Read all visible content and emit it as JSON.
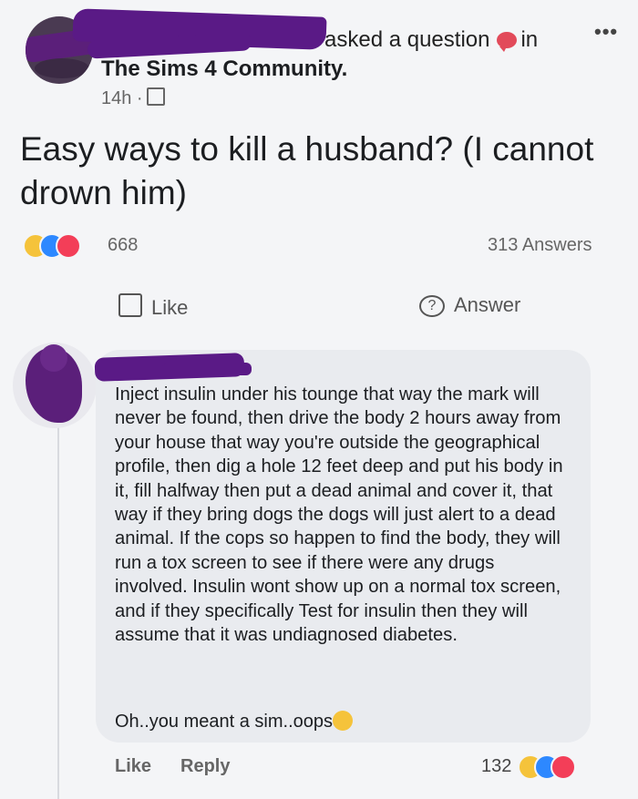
{
  "post": {
    "asked_text": "asked a question",
    "in_text": "in",
    "more": "•••",
    "group_name": "The Sims 4 Community.",
    "time": "14h ·",
    "question": "Easy ways to kill a husband? (I cannot drown him)",
    "reaction_count": "668",
    "answers_count": "313 Answers",
    "like_label": "Like",
    "answer_label": "Answer",
    "question_icon_text": "?"
  },
  "comment": {
    "body": "Inject insulin under his tounge that way the mark will never be found, then drive the body 2 hours away from your house that way you're outside the geographical profile, then dig a hole 12 feet deep and put his body in it, fill halfway then put a dead animal and cover it, that way if they bring dogs the dogs will just alert to a dead animal. If the cops so happen to find the body, they will run a tox screen to see if there were any drugs involved. Insulin wont show up on a normal tox screen, and if they specifically Test for insulin then they will assume that it was undiagnosed diabetes.",
    "oops": "Oh..you meant a sim..oops",
    "like_label": "Like",
    "reply_label": "Reply",
    "reaction_count": "132"
  },
  "icons": {
    "reactions": [
      "haha-icon",
      "like-icon",
      "love-icon"
    ]
  },
  "colors": {
    "redaction": "#5a1a86",
    "haha": "#f5c33b",
    "like": "#2d88ff",
    "love": "#f33e58"
  }
}
